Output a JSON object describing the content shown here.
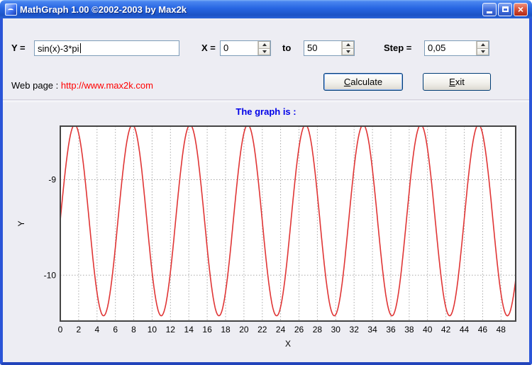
{
  "window": {
    "title": "MathGraph 1.00 ©2002-2003 by Max2k",
    "close_glyph": "×"
  },
  "form": {
    "y_label": "Y =",
    "y_value": "sin(x)-3*pi",
    "x_label": "X =",
    "x_value": "0",
    "to_label": "to",
    "to_value": "50",
    "step_label": "Step =",
    "step_value": "0,05",
    "webpage_label": "Web page :",
    "webpage_url": "http://www.max2k.com",
    "calculate_label": "Calculate",
    "exit_label": "Exit"
  },
  "graph": {
    "title": "The graph is :"
  },
  "chart_data": {
    "type": "line",
    "title": "The graph is :",
    "expression": "sin(x)-3*pi",
    "x_start": 0,
    "x_end": 50,
    "step": 0.05,
    "xlabel": "X",
    "ylabel": "Y",
    "xlim": [
      0,
      49.6
    ],
    "ylim": [
      -10.48,
      -8.44
    ],
    "x_ticks": [
      0,
      2,
      4,
      6,
      8,
      10,
      12,
      14,
      16,
      18,
      20,
      22,
      24,
      26,
      28,
      30,
      32,
      34,
      36,
      38,
      40,
      42,
      44,
      46,
      48
    ],
    "y_ticks": [
      -9,
      -10
    ],
    "grid": true,
    "legend": false,
    "line_color": "#e03535",
    "grid_color": "#a8a8a8",
    "border_color": "#444444",
    "plot_background": "#ffffff"
  },
  "colors": {
    "titlebar_blue": "#2765e2",
    "window_border": "#2b55d8",
    "client_bg": "#EDEDF3",
    "url_red": "#ff0000",
    "graph_title_blue": "#0000e8",
    "curve_red": "#e03535"
  }
}
